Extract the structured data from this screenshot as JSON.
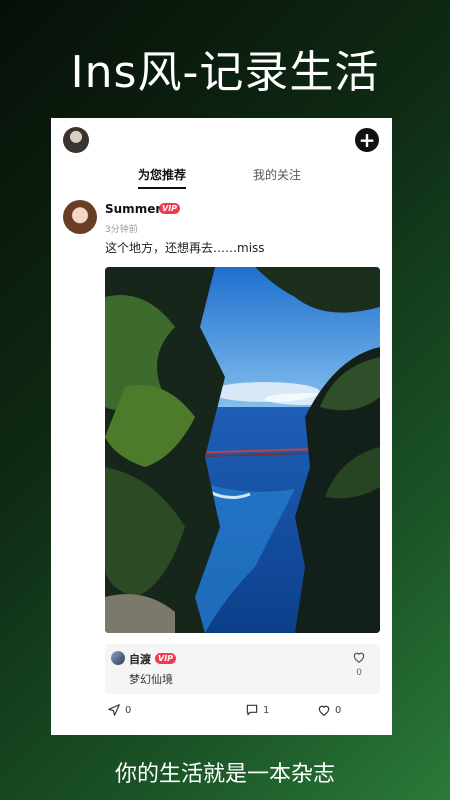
{
  "promo": {
    "headline": "Ins风-记录生活",
    "tagline": "你的生活就是一本杂志"
  },
  "app": {
    "tabs": [
      {
        "label": "为您推荐",
        "active": true
      },
      {
        "label": "我的关注",
        "active": false
      }
    ],
    "add_icon": "plus-icon"
  },
  "post": {
    "username": "Summer",
    "vip_badge": "VIP",
    "time": "3分钟前",
    "caption": "这个地方，还想再去……miss",
    "image_desc_icon": "landscape-photo",
    "quoted": {
      "username": "自渡",
      "vip_badge": "VIP",
      "text": "梦幻仙境",
      "likes": "0"
    },
    "actions": {
      "share_count": "0",
      "comment_count": "1",
      "like_count": "0"
    }
  },
  "colors": {
    "vip": "#ef3b4b",
    "accent": "#111111"
  }
}
